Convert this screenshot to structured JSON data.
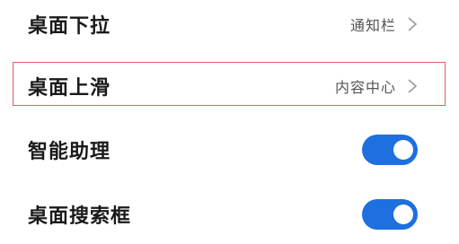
{
  "settings": {
    "items": [
      {
        "label": "桌面下拉",
        "value": "通知栏",
        "type": "link"
      },
      {
        "label": "桌面上滑",
        "value": "内容中心",
        "type": "link"
      },
      {
        "label": "智能助理",
        "value": "",
        "type": "toggle",
        "on": true
      },
      {
        "label": "桌面搜索框",
        "value": "",
        "type": "toggle",
        "on": true
      }
    ]
  },
  "colors": {
    "toggle_on": "#1e6fe0",
    "highlight_border": "#e06060"
  }
}
